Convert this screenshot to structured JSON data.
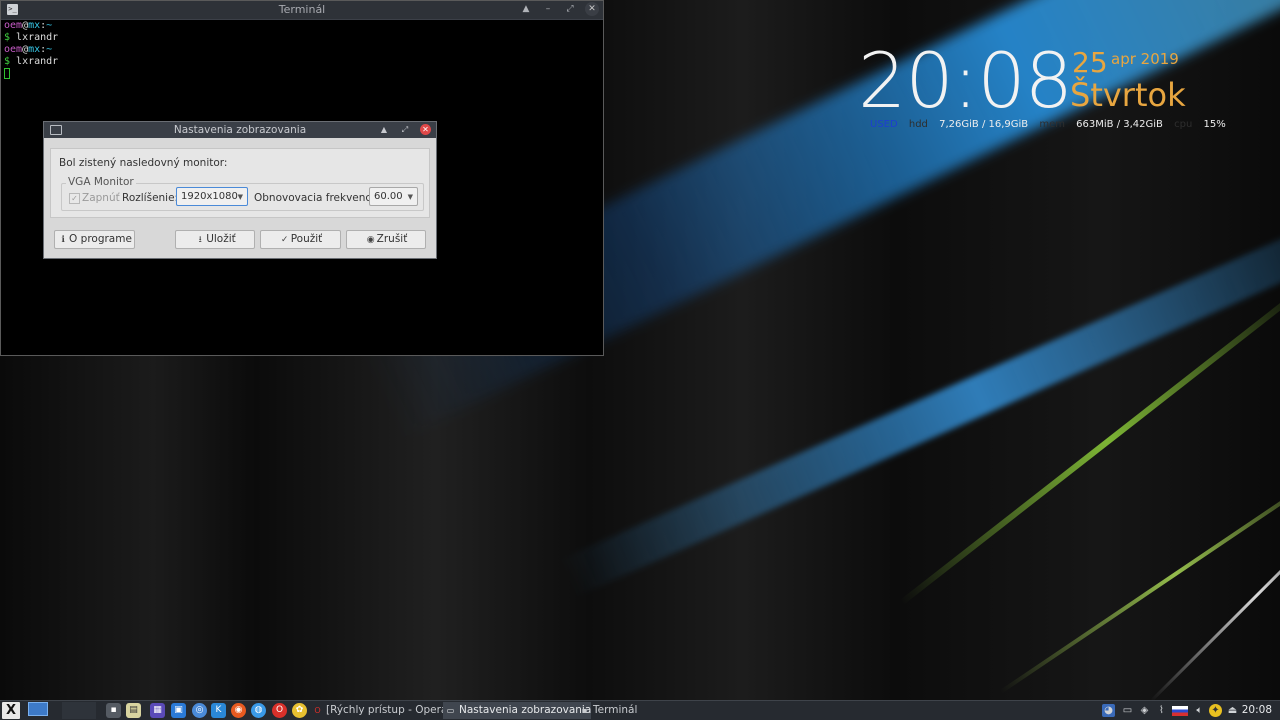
{
  "terminal": {
    "title": "Terminál",
    "lines": [
      {
        "user": "oem",
        "at": "@",
        "host": "mx",
        "sep": ":",
        "path": "~"
      },
      {
        "prompt": "$",
        "command": " lxrandr"
      },
      {
        "user": "oem",
        "at": "@",
        "host": "mx",
        "sep": ":",
        "path": "~"
      },
      {
        "prompt": "$",
        "command": " lxrandr"
      }
    ]
  },
  "dialog": {
    "title": "Nastavenia zobrazovania",
    "detected_label": "Bol zistený nasledovný monitor:",
    "group_label": "VGA Monitor",
    "enable_label": "Zapnúť",
    "resolution_label": "Rozlíšenie:",
    "resolution_value": "1920x1080",
    "refresh_label": "Obnovovacia frekvencia:",
    "refresh_value": "60.00",
    "about_label": "O programe",
    "save_label": "Uložiť",
    "apply_label": "Použiť",
    "cancel_label": "Zrušiť"
  },
  "conky": {
    "time": "20:08",
    "day": "25",
    "month_year": "apr 2019",
    "weekday": "Štvrtok",
    "used_label": "USED",
    "hdd_label": "hdd",
    "hdd_value": "7,26GiB / 16,9GiB",
    "mem_label": "mem",
    "mem_value": "663MiB / 3,42GiB",
    "cpu_label": "cpu",
    "cpu_value": "15%"
  },
  "taskbar": {
    "start_label": "X",
    "tasks": [
      {
        "label": "[Rýchly prístup - Opera]"
      },
      {
        "label": "Nastavenia zobrazovania"
      },
      {
        "label": "Terminál"
      }
    ],
    "clock": "20:08"
  }
}
